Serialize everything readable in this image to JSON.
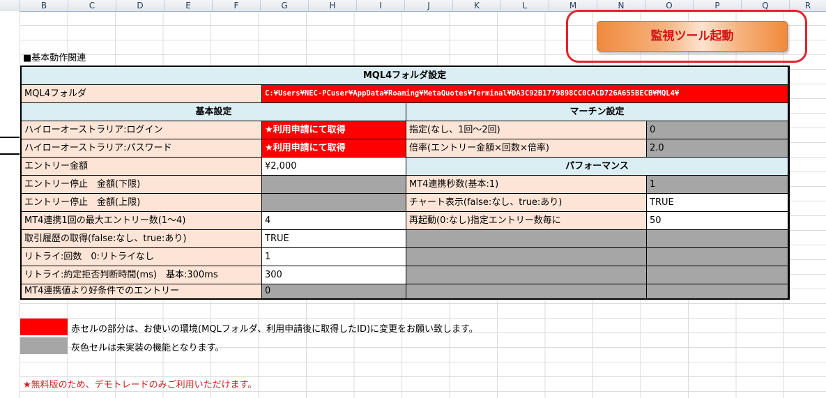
{
  "columns": [
    "B",
    "C",
    "D",
    "E",
    "F",
    "G",
    "H",
    "I",
    "J",
    "K",
    "L",
    "M",
    "N",
    "O",
    "P",
    "Q",
    "R"
  ],
  "caption": "■基本動作関連",
  "launch_button": "監視ツール起動",
  "mql4_header": "MQL4フォルダ設定",
  "mql4_label": "MQL4フォルダ",
  "mql4_path": "C:¥Users¥NEC-PCuser¥AppData¥Roaming¥MetaQuotes¥Terminal¥DA3C92B1779898CC0CACD726A655BECB¥MQL4¥",
  "basic": {
    "header": "基本設定",
    "rows": [
      {
        "label": "ハイローオーストラリア:ログイン",
        "value": "★利用申請にて取得",
        "style": "red"
      },
      {
        "label": "ハイローオーストラリア:パスワード",
        "value": "★利用申請にて取得",
        "style": "red"
      },
      {
        "label": "エントリー金額",
        "value": "¥2,000",
        "style": "wht"
      },
      {
        "label": "エントリー停止　金額(下限)",
        "value": "",
        "style": "gray"
      },
      {
        "label": "エントリー停止　金額(上限)",
        "value": "",
        "style": "gray"
      },
      {
        "label": "MT4連携1回の最大エントリー数(1〜4)",
        "value": "4",
        "style": "wht"
      },
      {
        "label": "取引履歴の取得(false:なし、true:あり)",
        "value": "TRUE",
        "style": "wht"
      },
      {
        "label": "リトライ:回数　0:リトライなし",
        "value": "1",
        "style": "wht"
      },
      {
        "label": "リトライ:約定拒否判断時間(ms)　基本:300ms",
        "value": "300",
        "style": "wht"
      },
      {
        "label": "MT4連携値より好条件でのエントリー",
        "value": "0",
        "style": "gray"
      }
    ]
  },
  "martin": {
    "header": "マーチン設定",
    "rows": [
      {
        "label": "指定(なし、1回〜2回)",
        "value": "0",
        "style": "gray"
      },
      {
        "label": "倍率(エントリー金額×回数×倍率)",
        "value": "2.0",
        "style": "gray"
      }
    ]
  },
  "performance": {
    "header": "パフォーマンス",
    "rows": [
      {
        "label": "MT4連携秒数(基本:1)",
        "value": "1",
        "style": "gray"
      },
      {
        "label": "チャート表示(false:なし、true:あり)",
        "value": "TRUE",
        "style": "wht"
      },
      {
        "label": "再起動(0:なし)指定エントリー数毎に",
        "value": "50",
        "style": "wht"
      }
    ]
  },
  "legend": {
    "red_text": "赤セルの部分は、お使いの環境(MQLフォルダ、利用申請後に取得したID)に変更をお願い致します。",
    "gray_text": "灰色セルは未実装の機能となります。",
    "red_color": "#ff0000",
    "gray_color": "#a6a6a6"
  },
  "note": "★無料版のため、デモトレードのみご利用いただけます。"
}
